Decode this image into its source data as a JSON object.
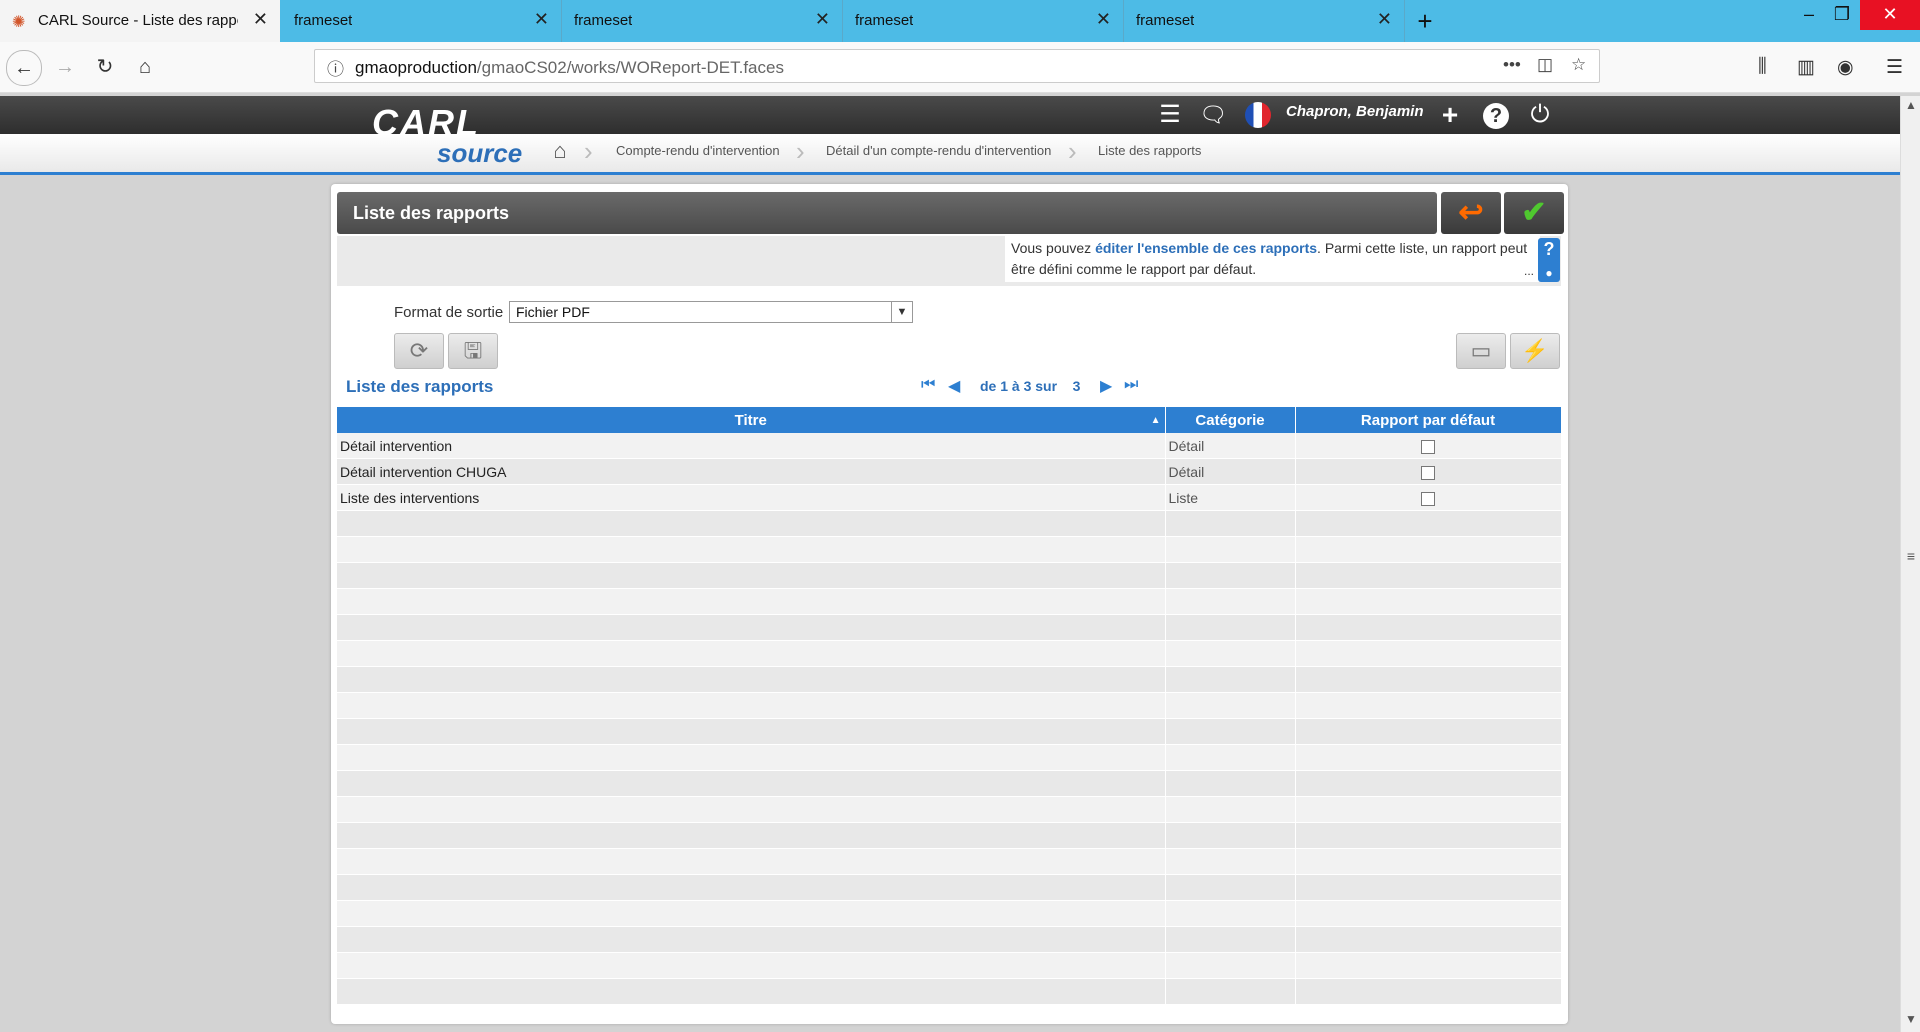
{
  "browser": {
    "tabs": [
      {
        "label": "CARL Source - Liste des rappor",
        "active": true
      },
      {
        "label": "frameset",
        "active": false
      },
      {
        "label": "frameset",
        "active": false
      },
      {
        "label": "frameset",
        "active": false
      }
    ],
    "url_host": "gmaoproduction",
    "url_path": "/gmaoCS02/works/WOReport-DET.faces"
  },
  "app": {
    "logo_top": "CARL",
    "logo_bottom": "source",
    "user": "Chapron, Benjamin",
    "breadcrumbs": [
      "Compte-rendu d'intervention",
      "Détail d'un compte-rendu d'intervention",
      "Liste des rapports"
    ]
  },
  "panel": {
    "title": "Liste des rapports",
    "info_pre": "Vous pouvez ",
    "info_link": "éditer l'ensemble de ces rapports",
    "info_post": ". Parmi cette liste, un rapport peut être défini comme le rapport par défaut.",
    "info_more": "...",
    "help_label": "?",
    "format_label": "Format de sortie",
    "format_value": "Fichier PDF",
    "list_title": "Liste des rapports",
    "pagination": "de 1 à 3 sur",
    "total": "3"
  },
  "table": {
    "columns": [
      "Titre",
      "Catégorie",
      "Rapport par défaut"
    ],
    "rows": [
      {
        "title": "Détail intervention",
        "category": "Détail",
        "default": false
      },
      {
        "title": "Détail intervention CHUGA",
        "category": "Détail",
        "default": false
      },
      {
        "title": "Liste des interventions",
        "category": "Liste",
        "default": false
      }
    ]
  },
  "colors": {
    "accent": "#2d7fd1",
    "tab_bar": "#4dbbe6",
    "back_icon": "#ff6a00",
    "ok_icon": "#4fc82f"
  }
}
